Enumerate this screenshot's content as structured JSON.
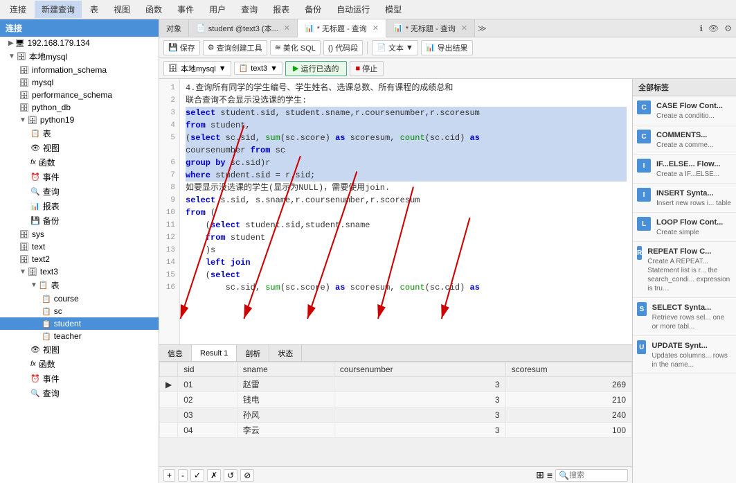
{
  "menuBar": {
    "items": [
      "连接",
      "新建查询",
      "表",
      "视图",
      "函数",
      "事件",
      "用户",
      "查询",
      "报表",
      "备份",
      "自动运行",
      "模型"
    ]
  },
  "tabs": {
    "items": [
      {
        "label": "对象",
        "icon": "📋",
        "active": false
      },
      {
        "label": "student @text3 (本...",
        "icon": "📄",
        "active": false
      },
      {
        "label": "* 无标题 - 查询",
        "icon": "📊",
        "active": true
      },
      {
        "label": "* 无标题 - 查询",
        "icon": "📊",
        "active": false
      }
    ]
  },
  "toolbar": {
    "save": "保存",
    "queryBuilder": "查询创建工具",
    "beautifySQL": "美化 SQL",
    "codeBlock": "() 代码段",
    "text": "文本",
    "exportResults": "导出结果"
  },
  "queryToolbar": {
    "database": "本地mysql",
    "table": "text3",
    "runSelected": "运行已选的",
    "stop": "停止"
  },
  "sidebar": {
    "connection": "连接",
    "servers": [
      {
        "label": "192.168.179.134",
        "icon": "🖥",
        "expanded": false
      },
      {
        "label": "本地mysql",
        "icon": "🗄",
        "expanded": true,
        "children": [
          {
            "label": "information_schema",
            "icon": "🗄",
            "type": "db"
          },
          {
            "label": "mysql",
            "icon": "🗄",
            "type": "db"
          },
          {
            "label": "performance_schema",
            "icon": "🗄",
            "type": "db"
          },
          {
            "label": "python_db",
            "icon": "🗄",
            "type": "db"
          },
          {
            "label": "python19",
            "icon": "🗄",
            "type": "db",
            "expanded": true,
            "children": [
              {
                "label": "表",
                "icon": "📋",
                "type": "folder"
              },
              {
                "label": "视图",
                "icon": "👁",
                "type": "folder"
              },
              {
                "label": "函数",
                "icon": "fx",
                "type": "folder"
              },
              {
                "label": "事件",
                "icon": "⏰",
                "type": "folder"
              },
              {
                "label": "查询",
                "icon": "🔍",
                "type": "folder"
              },
              {
                "label": "报表",
                "icon": "📊",
                "type": "folder"
              },
              {
                "label": "备份",
                "icon": "💾",
                "type": "folder"
              }
            ]
          },
          {
            "label": "sys",
            "icon": "🗄",
            "type": "db"
          },
          {
            "label": "text",
            "icon": "🗄",
            "type": "db"
          },
          {
            "label": "text2",
            "icon": "🗄",
            "type": "db"
          },
          {
            "label": "text3",
            "icon": "🗄",
            "type": "db",
            "expanded": true,
            "children": [
              {
                "label": "表",
                "icon": "📋",
                "type": "folder",
                "expanded": true,
                "children": [
                  {
                    "label": "course",
                    "icon": "📋",
                    "type": "table"
                  },
                  {
                    "label": "sc",
                    "icon": "📋",
                    "type": "table"
                  },
                  {
                    "label": "student",
                    "icon": "📋",
                    "type": "table",
                    "selected": true
                  },
                  {
                    "label": "teacher",
                    "icon": "📋",
                    "type": "table"
                  }
                ]
              },
              {
                "label": "视图",
                "icon": "👁",
                "type": "folder"
              },
              {
                "label": "函数",
                "icon": "fx",
                "type": "folder"
              },
              {
                "label": "事件",
                "icon": "⏰",
                "type": "folder"
              },
              {
                "label": "查询",
                "icon": "🔍",
                "type": "folder"
              }
            ]
          }
        ]
      }
    ]
  },
  "editor": {
    "lines": [
      {
        "num": 1,
        "text": "4.查询所有同学的学生编号、学生姓名、选课总数、所有课程的成绩总和",
        "selected": false
      },
      {
        "num": 2,
        "text": "联合查询不会显示没选课的学生:",
        "selected": false
      },
      {
        "num": 3,
        "text": "select student.sid, student.sname,r.coursenumber,r.scoresum",
        "selected": true,
        "hasKw": true
      },
      {
        "num": 4,
        "text": "from student,",
        "selected": true,
        "hasKw": true
      },
      {
        "num": 5,
        "text": "(select sc.sid, sum(sc.score) as scoresum, count(sc.cid) as",
        "selected": true,
        "hasKw": true
      },
      {
        "num": "",
        "text": "coursenumber from sc",
        "selected": true
      },
      {
        "num": 6,
        "text": "group by sc.sid)r",
        "selected": true,
        "hasKw": true
      },
      {
        "num": 7,
        "text": "where student.sid = r.sid;",
        "selected": true,
        "hasKw": true
      },
      {
        "num": 8,
        "text": "如要显示没选课的学生(显示为NULL)，需要使用join.",
        "selected": false
      },
      {
        "num": 9,
        "text": "select s.sid, s.sname,r.coursenumber,r.scoresum",
        "selected": false,
        "hasKw": true
      },
      {
        "num": 10,
        "text": "from (",
        "selected": false,
        "hasKw": true
      },
      {
        "num": 11,
        "text": "    (select student.sid,student.sname",
        "selected": false,
        "hasKw": true
      },
      {
        "num": 12,
        "text": "    from student",
        "selected": false,
        "hasKw": true
      },
      {
        "num": 13,
        "text": "    )s",
        "selected": false
      },
      {
        "num": 14,
        "text": "    left join",
        "selected": false,
        "hasKw": true
      },
      {
        "num": 15,
        "text": "    (select",
        "selected": false,
        "hasKw": true
      },
      {
        "num": 16,
        "text": "        sc.sid, sum(sc.score) as scoresum, count(sc.cid) as",
        "selected": false,
        "hasKw": true
      }
    ]
  },
  "resultsTabs": [
    "信息",
    "Result 1",
    "剖析",
    "状态"
  ],
  "resultsActiveTab": "Result 1",
  "resultsTable": {
    "columns": [
      "sid",
      "sname",
      "coursenumber",
      "scoresum"
    ],
    "rows": [
      {
        "marker": "▶",
        "sid": "01",
        "sname": "赵雷",
        "coursenumber": "3",
        "scoresum": "269"
      },
      {
        "marker": "",
        "sid": "02",
        "sname": "钱电",
        "coursenumber": "3",
        "scoresum": "210"
      },
      {
        "marker": "",
        "sid": "03",
        "sname": "孙风",
        "coursenumber": "3",
        "scoresum": "240"
      },
      {
        "marker": "",
        "sid": "04",
        "sname": "李云",
        "coursenumber": "3",
        "scoresum": "100"
      }
    ]
  },
  "bottomBar": {
    "buttons": [
      "+",
      "-",
      "✓",
      "✗",
      "↺",
      "⊘"
    ]
  },
  "snippetsPanel": {
    "header": "全部标签",
    "items": [
      {
        "id": "CASE",
        "title": "CASE Flow Cont...",
        "desc": "Create a conditio...",
        "color": "#4a90d9"
      },
      {
        "id": "CM",
        "title": "COMMENTS...",
        "desc": "Create a comme...",
        "color": "#4a90d9"
      },
      {
        "id": "IF",
        "title": "IF...ELSE... Flow...",
        "desc": "Create a IF...ELSE...",
        "color": "#4a90d9"
      },
      {
        "id": "IN",
        "title": "INSERT Synta...",
        "desc": "Insert new rows i... table",
        "color": "#4a90d9"
      },
      {
        "id": "LP",
        "title": "LOOP Flow Cont...",
        "desc": "Create simple",
        "color": "#4a90d9"
      },
      {
        "id": "RP",
        "title": "REPEAT Flow C...",
        "desc": "Create A REPEAT... Statement list is n... the search_condi... expression is tru...",
        "color": "#4a90d9"
      },
      {
        "id": "SE",
        "title": "SELECT Synta...",
        "desc": "Retrieve rows sel... one or more tabl...",
        "color": "#4a90d9"
      },
      {
        "id": "UP",
        "title": "UPDATE Synt...",
        "desc": "Updates columns... rows in the name...",
        "color": "#4a90d9"
      }
    ]
  },
  "searchPlaceholder": "搜索"
}
